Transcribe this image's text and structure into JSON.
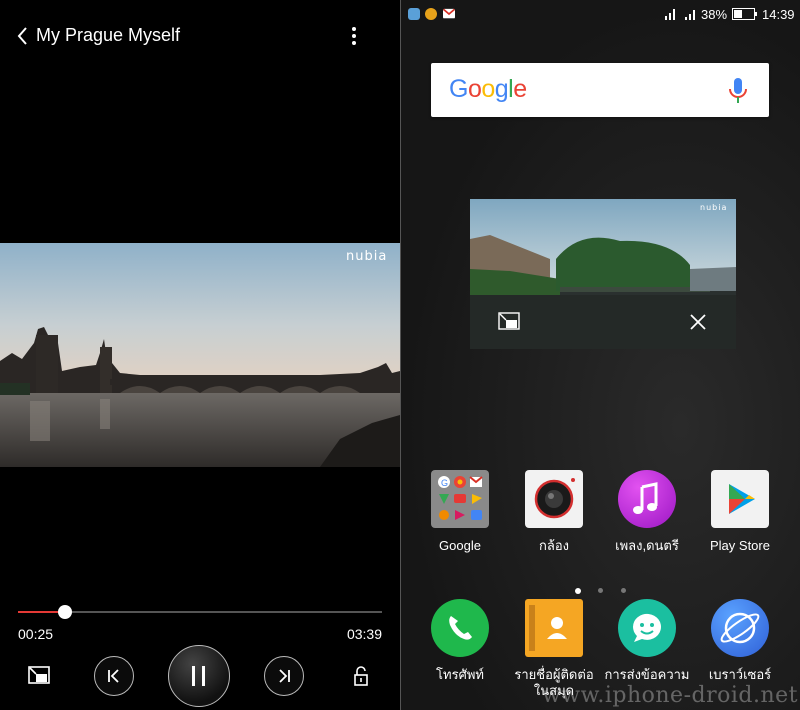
{
  "player": {
    "title": "My Prague Myself",
    "brand_watermark": "nubia",
    "elapsed": "00:25",
    "duration": "03:39",
    "progress_fraction": 0.13,
    "accent_color": "#e53935"
  },
  "status_bar": {
    "battery": "38%",
    "time": "14:39",
    "notification_icons": [
      "gallery-icon",
      "badge-icon",
      "gmail-icon"
    ]
  },
  "search": {
    "logo": "Google",
    "logo_colors": [
      "#4285F4",
      "#EA4335",
      "#FBBC05",
      "#4285F4",
      "#34A853",
      "#EA4335"
    ]
  },
  "pip": {
    "brand_watermark": "nubia"
  },
  "apps": [
    {
      "label": "Google",
      "icon": "google-folder-icon"
    },
    {
      "label": "กล้อง",
      "icon": "camera-icon"
    },
    {
      "label": "เพลง,ดนตรี",
      "icon": "music-icon"
    },
    {
      "label": "Play Store",
      "icon": "play-store-icon"
    }
  ],
  "dock": [
    {
      "label": "โทรศัพท์",
      "icon": "phone-icon"
    },
    {
      "label": "รายชื่อผู้ติดต่อในสมุด",
      "icon": "contacts-icon"
    },
    {
      "label": "การส่งข้อความ",
      "icon": "messaging-icon"
    },
    {
      "label": "เบราว์เซอร์",
      "icon": "browser-icon"
    }
  ],
  "page_indicator": {
    "count": 3,
    "active": 0
  },
  "watermark": "www.iphone-droid.net"
}
